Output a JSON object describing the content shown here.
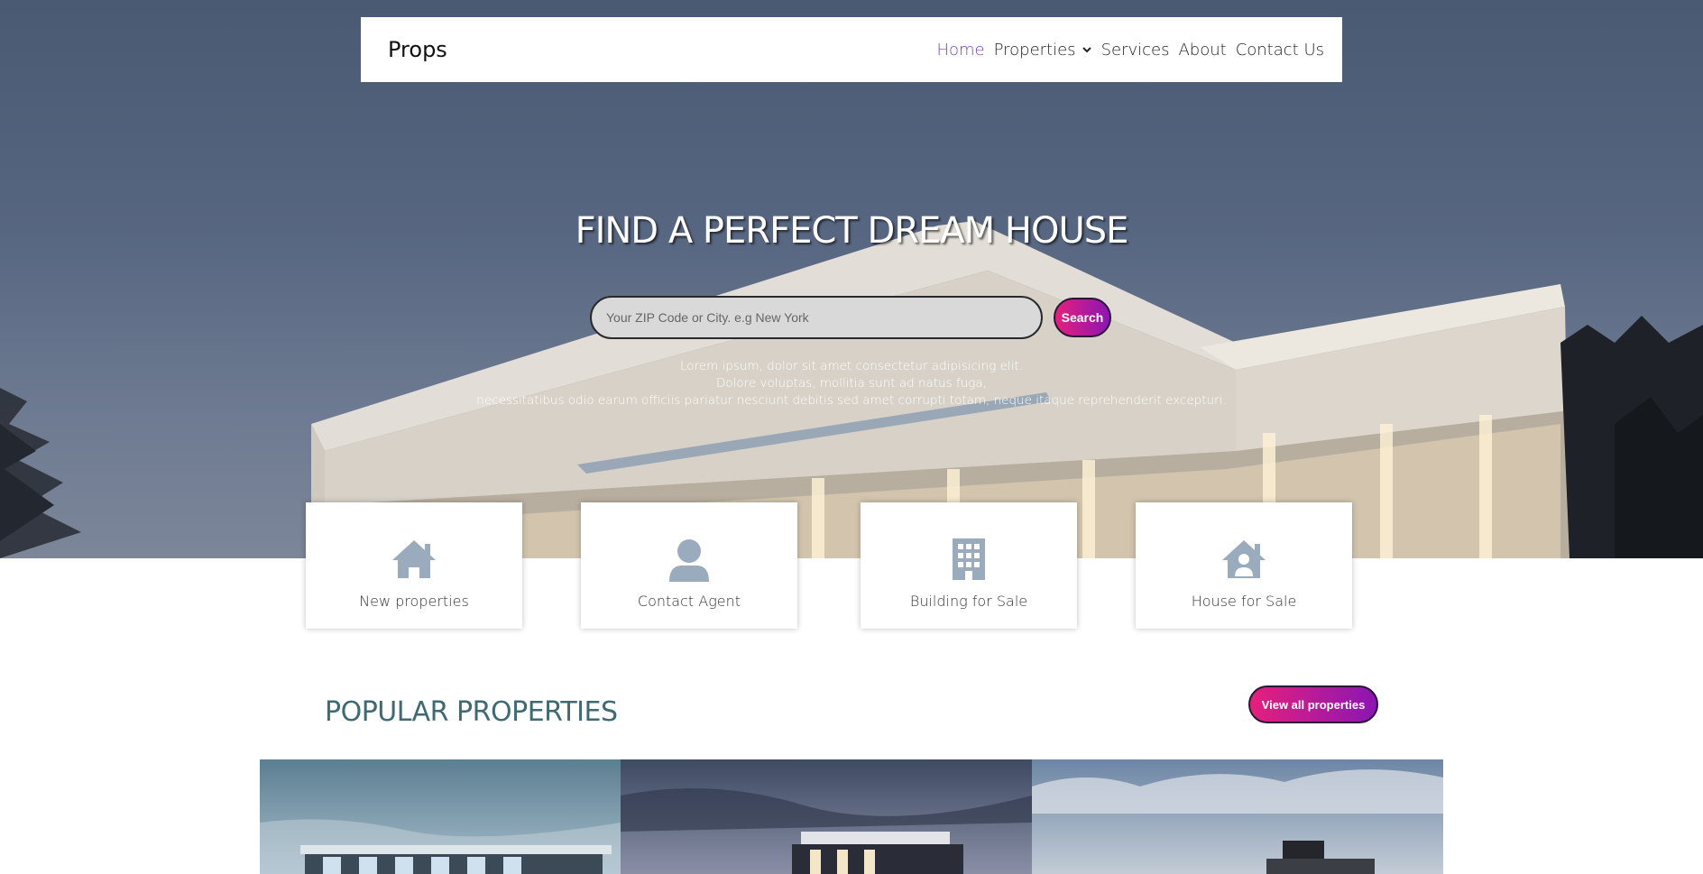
{
  "navbar": {
    "brand": "Props",
    "links": [
      {
        "label": "Home",
        "active": true
      },
      {
        "label": "Properties",
        "dropdown": true
      },
      {
        "label": "Services"
      },
      {
        "label": "About"
      },
      {
        "label": "Contact Us"
      }
    ]
  },
  "hero": {
    "headline": "FIND A PERFECT DREAM HOUSE",
    "search": {
      "placeholder": "Your ZIP Code or City. e.g New York",
      "value": "",
      "button_label": "Search"
    },
    "description_lines": [
      "Lorem ipsum, dolor sit amet consectetur adipisicing elit.",
      "Dolore voluptas, mollitia sunt ad natus fuga,",
      "necessitatibus odio earum officiis pariatur nesciunt debitis sed amet corrupti totam, neque itaque reprehenderit excepturi."
    ]
  },
  "cards": [
    {
      "label": "New properties",
      "icon": "house-icon"
    },
    {
      "label": "Contact Agent",
      "icon": "user-icon"
    },
    {
      "label": "Building for Sale",
      "icon": "building-icon"
    },
    {
      "label": "House for Sale",
      "icon": "house-user-icon"
    }
  ],
  "popular": {
    "title": "POPULAR PROPERTIES",
    "view_all_label": "View all properties"
  },
  "colors": {
    "accent_active": "#7b3fb0",
    "gradient_start": "#e5207c",
    "gradient_end": "#8b16b3",
    "icon": "#9aabbe",
    "section_title": "#3f6a72"
  }
}
